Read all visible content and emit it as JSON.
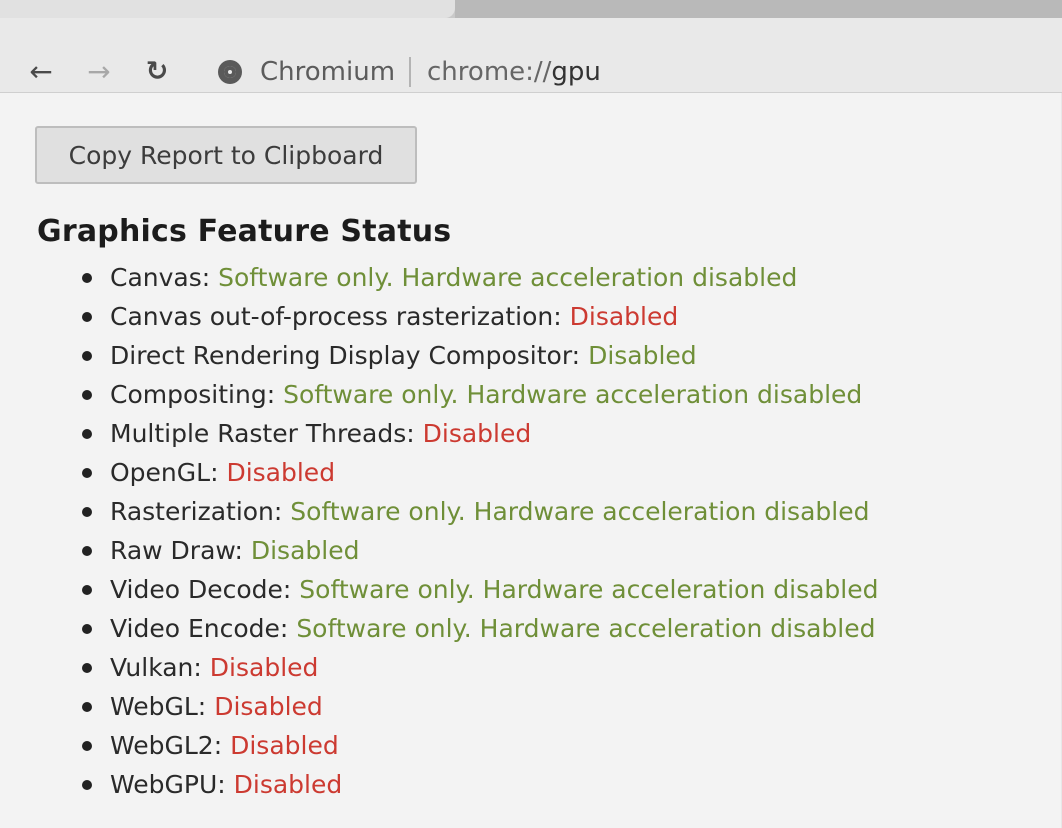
{
  "browser": {
    "origin_label": "Chromium",
    "url_scheme": "chrome://",
    "url_path": "gpu",
    "back_icon": "arrow-left-icon",
    "forward_icon": "arrow-right-icon",
    "reload_icon": "reload-icon",
    "site_icon": "chromium-logo-icon"
  },
  "page": {
    "copy_button_label": "Copy Report to Clipboard",
    "section_title": "Graphics Feature Status",
    "features": [
      {
        "name": "Canvas:",
        "status": "Software only. Hardware acceleration disabled",
        "tone": "green"
      },
      {
        "name": "Canvas out-of-process rasterization:",
        "status": "Disabled",
        "tone": "red"
      },
      {
        "name": "Direct Rendering Display Compositor:",
        "status": "Disabled",
        "tone": "green"
      },
      {
        "name": "Compositing:",
        "status": "Software only. Hardware acceleration disabled",
        "tone": "green"
      },
      {
        "name": "Multiple Raster Threads:",
        "status": "Disabled",
        "tone": "red"
      },
      {
        "name": "OpenGL:",
        "status": "Disabled",
        "tone": "red"
      },
      {
        "name": "Rasterization:",
        "status": "Software only. Hardware acceleration disabled",
        "tone": "green"
      },
      {
        "name": "Raw Draw:",
        "status": "Disabled",
        "tone": "green"
      },
      {
        "name": "Video Decode:",
        "status": "Software only. Hardware acceleration disabled",
        "tone": "green"
      },
      {
        "name": "Video Encode:",
        "status": "Software only. Hardware acceleration disabled",
        "tone": "green"
      },
      {
        "name": "Vulkan:",
        "status": "Disabled",
        "tone": "red"
      },
      {
        "name": "WebGL:",
        "status": "Disabled",
        "tone": "red"
      },
      {
        "name": "WebGL2:",
        "status": "Disabled",
        "tone": "red"
      },
      {
        "name": "WebGPU:",
        "status": "Disabled",
        "tone": "red"
      }
    ]
  },
  "colors": {
    "status_green": "#6f8f38",
    "status_red": "#cc3a31"
  }
}
